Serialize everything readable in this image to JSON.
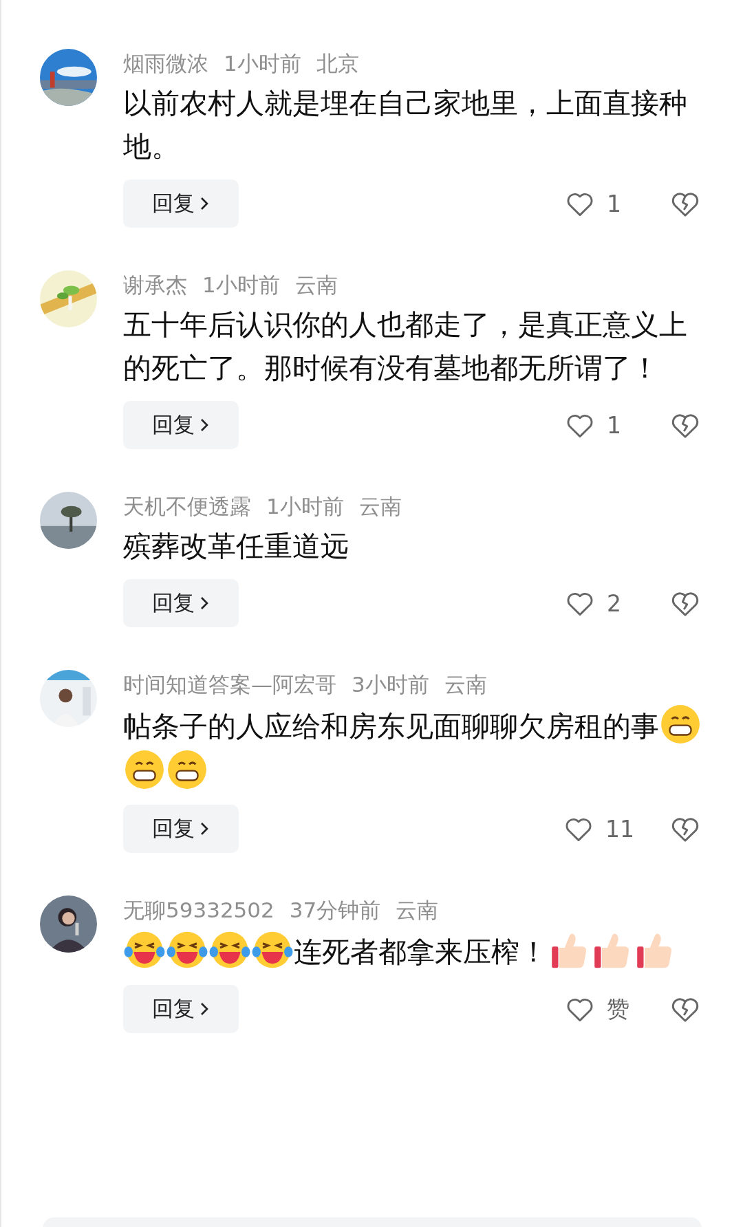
{
  "comments": [
    {
      "user": "烟雨微浓",
      "time": "1小时前",
      "location": "北京",
      "avatar": {
        "kind": "picture"
      },
      "body": [
        {
          "kind": "text",
          "text": "以前农村人就是埋在自己家地里，上面直接种地。"
        }
      ],
      "reply": "回复",
      "likes": "1"
    },
    {
      "user": "谢承杰",
      "time": "1小时前",
      "location": "云南",
      "avatar": {
        "kind": "picture"
      },
      "body": [
        {
          "kind": "text",
          "text": "五十年后认识你的人也都走了，是真正意义上的死亡了。那时候有没有墓地都无所谓了！"
        }
      ],
      "reply": "回复",
      "likes": "1"
    },
    {
      "user": "天机不便透露",
      "time": "1小时前",
      "location": "云南",
      "avatar": {
        "kind": "picture"
      },
      "body": [
        {
          "kind": "text",
          "text": "殡葬改革任重道远"
        }
      ],
      "reply": "回复",
      "likes": "2"
    },
    {
      "user": "时间知道答案—阿宏哥",
      "time": "3小时前",
      "location": "云南",
      "avatar": {
        "kind": "picture"
      },
      "body": [
        {
          "kind": "text",
          "text": "帖条子的人应给和房东见面聊聊欠房租的事"
        },
        {
          "kind": "grin"
        },
        {
          "kind": "grin"
        },
        {
          "kind": "grin"
        }
      ],
      "reply": "回复",
      "likes": "11"
    },
    {
      "user": "无聊59332502",
      "time": "37分钟前",
      "location": "云南",
      "avatar": {
        "kind": "picture"
      },
      "body": [
        {
          "kind": "tears"
        },
        {
          "kind": "tears"
        },
        {
          "kind": "tears"
        },
        {
          "kind": "tears"
        },
        {
          "kind": "text",
          "text": "连死者都拿来压榨！"
        },
        {
          "kind": "thumb"
        },
        {
          "kind": "thumb"
        },
        {
          "kind": "thumb"
        }
      ],
      "reply": "回复",
      "likes": "赞"
    }
  ]
}
